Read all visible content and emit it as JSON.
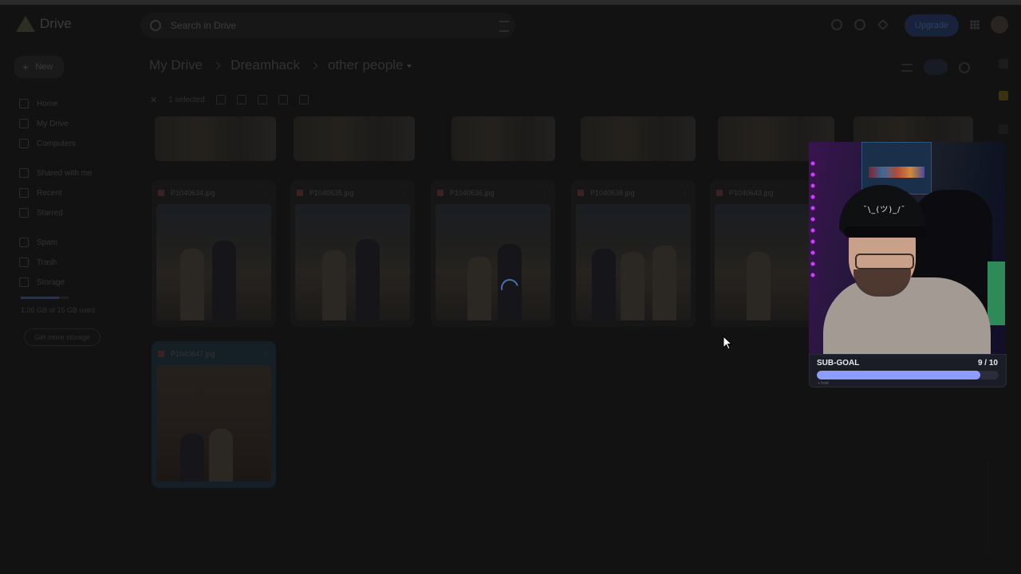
{
  "header": {
    "app_name": "Drive",
    "search_placeholder": "Search in Drive",
    "upgrade_label": "Upgrade"
  },
  "sidebar": {
    "new_label": "New",
    "items": [
      {
        "label": "Home",
        "icon": "home-icon"
      },
      {
        "label": "My Drive",
        "icon": "drive-icon"
      },
      {
        "label": "Computers",
        "icon": "computer-icon"
      },
      {
        "label": "Shared with me",
        "icon": "people-icon"
      },
      {
        "label": "Recent",
        "icon": "clock-icon"
      },
      {
        "label": "Starred",
        "icon": "star-icon"
      },
      {
        "label": "Spam",
        "icon": "spam-icon"
      },
      {
        "label": "Trash",
        "icon": "trash-icon"
      },
      {
        "label": "Storage",
        "icon": "cloud-icon"
      }
    ],
    "storage_text": "1.06 GB of 15 GB used",
    "get_storage_label": "Get more storage"
  },
  "breadcrumb": {
    "items": [
      "My Drive",
      "Dreamhack",
      "other people"
    ]
  },
  "toolbar": {
    "selected_label": "1 selected"
  },
  "files": [
    {
      "name": "P1040634.jpg"
    },
    {
      "name": "P1040635.jpg"
    },
    {
      "name": "P1040636.jpg"
    },
    {
      "name": "P1040638.jpg"
    },
    {
      "name": "P1040643.jpg"
    },
    {
      "name": "P1040647.jpg"
    }
  ],
  "overlay": {
    "cap_text": "¯\\_(ツ)_/¯",
    "goal_label": "SUB-GOAL",
    "goal_count": "9 / 10",
    "goal_progress": 0.9,
    "goal_sub": "+ host"
  },
  "colors": {
    "goal_fill": "#8c9cff",
    "spinner": "#4a6fb0"
  }
}
